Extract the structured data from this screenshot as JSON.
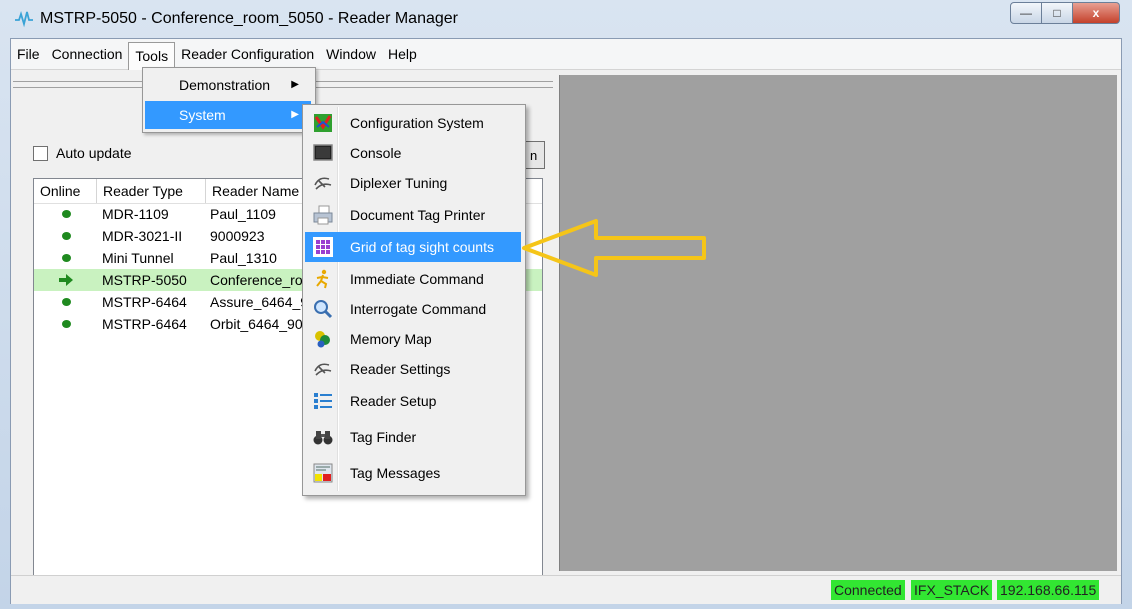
{
  "window": {
    "title": "MSTRP-5050 - Conference_room_5050 - Reader Manager",
    "min_glyph": "—",
    "max_glyph": "□",
    "close_glyph": "x"
  },
  "menubar": {
    "items": [
      "File",
      "Connection",
      "Tools",
      "Reader Configuration",
      "Window",
      "Help"
    ],
    "open_menu": "Tools"
  },
  "tools_menu": {
    "items": [
      {
        "label": "Demonstration",
        "has_submenu": true
      },
      {
        "label": "System",
        "has_submenu": true,
        "highlighted": true
      }
    ],
    "chevron": "▶"
  },
  "system_submenu": {
    "items": [
      {
        "label": "Configuration System",
        "icon": "configuration-icon"
      },
      {
        "label": "Console",
        "icon": "console-icon"
      },
      {
        "label": "Diplexer Tuning",
        "icon": "tuning-hand-icon"
      },
      {
        "label": "Document Tag Printer",
        "icon": "printer-icon"
      },
      {
        "label": "Grid of tag sight counts",
        "icon": "grid-icon",
        "highlighted": true
      },
      {
        "label": "Immediate Command",
        "icon": "running-figure-icon"
      },
      {
        "label": "Interrogate Command",
        "icon": "magnifier-icon"
      },
      {
        "label": "Memory Map",
        "icon": "memory-map-icon"
      },
      {
        "label": "Reader Settings",
        "icon": "settings-hand-icon"
      },
      {
        "label": "Reader Setup",
        "icon": "setup-list-icon"
      },
      {
        "label": "Tag Finder",
        "icon": "binoculars-icon"
      },
      {
        "label": "Tag Messages",
        "icon": "tag-messages-icon"
      }
    ]
  },
  "left_panel": {
    "auto_update_label": "Auto update",
    "auto_update_checked": false,
    "partial_button_text": "n"
  },
  "reader_list": {
    "columns": [
      "Online",
      "Reader Type",
      "Reader Name"
    ],
    "rows": [
      {
        "status": "online",
        "type": "MDR-1109",
        "name": "Paul_1109"
      },
      {
        "status": "online",
        "type": "MDR-3021-II",
        "name": "9000923"
      },
      {
        "status": "online",
        "type": "Mini Tunnel",
        "name": "Paul_1310"
      },
      {
        "status": "current",
        "type": "MSTRP-5050",
        "name": "Conference_ro",
        "selected": true
      },
      {
        "status": "online",
        "type": "MSTRP-6464",
        "name": "Assure_6464_9"
      },
      {
        "status": "online",
        "type": "MSTRP-6464",
        "name": "Orbit_6464_90"
      }
    ]
  },
  "status_bar": {
    "segments": [
      "Connected",
      "IFX_STACK",
      "192.168.66.115"
    ]
  },
  "colors": {
    "highlight": "#3399ff",
    "selected_row": "#c9f2c0",
    "status_green": "#32e632",
    "online_dot": "#1f8a1f",
    "annotation_arrow": "#f5c518"
  }
}
